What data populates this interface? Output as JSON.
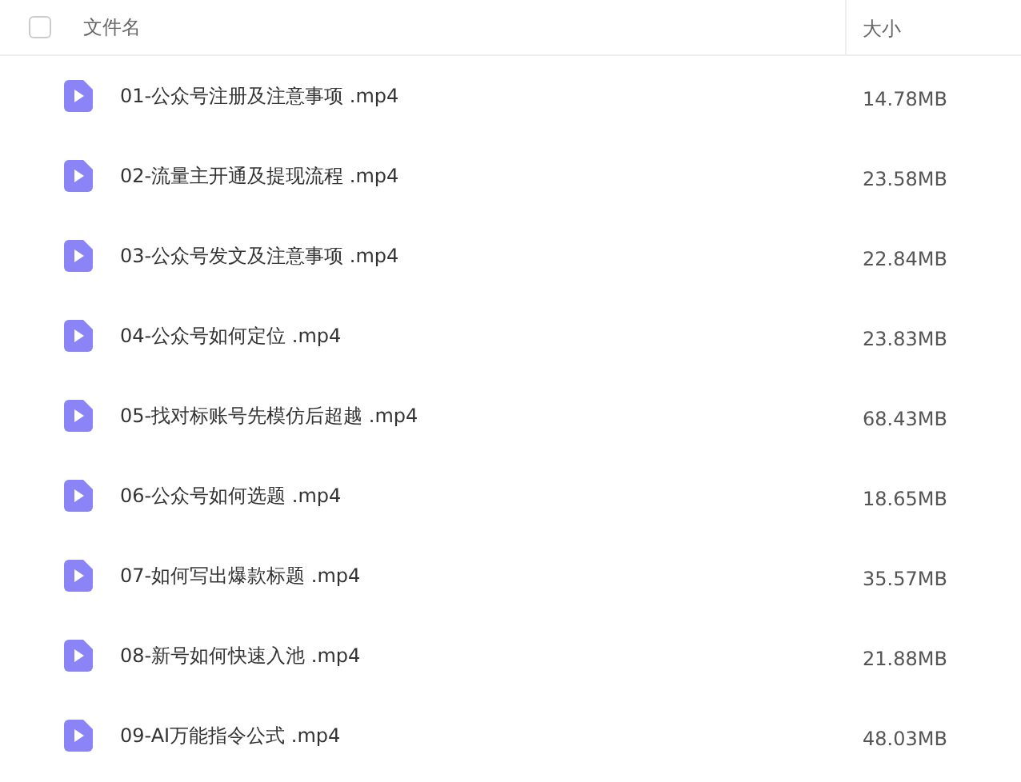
{
  "header": {
    "select_all_checked": false,
    "columns": [
      "文件名",
      "大小"
    ]
  },
  "files": [
    {
      "name": "01-公众号注册及注意事项 .mp4",
      "size": "14.78MB"
    },
    {
      "name": "02-流量主开通及提现流程 .mp4",
      "size": "23.58MB"
    },
    {
      "name": "03-公众号发文及注意事项 .mp4",
      "size": "22.84MB"
    },
    {
      "name": "04-公众号如何定位 .mp4",
      "size": "23.83MB"
    },
    {
      "name": "05-找对标账号先模仿后超越 .mp4",
      "size": "68.43MB"
    },
    {
      "name": "06-公众号如何选题 .mp4",
      "size": "18.65MB"
    },
    {
      "name": "07-如何写出爆款标题 .mp4",
      "size": "35.57MB"
    },
    {
      "name": "08-新号如何快速入池 .mp4",
      "size": "21.88MB"
    },
    {
      "name": "09-AI万能指令公式 .mp4",
      "size": "48.03MB"
    }
  ]
}
